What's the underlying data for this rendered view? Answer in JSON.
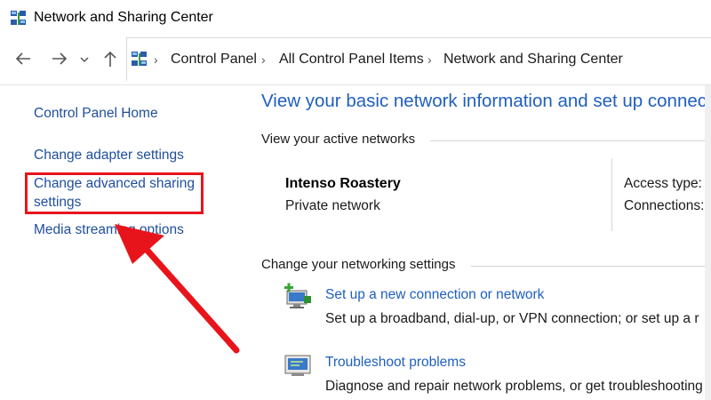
{
  "window": {
    "title": "Network and Sharing Center"
  },
  "nav": {
    "icons": [
      "back-arrow-icon",
      "forward-arrow-icon",
      "recent-dropdown-icon",
      "up-arrow-icon"
    ]
  },
  "breadcrumb": {
    "items": [
      "Control Panel",
      "All Control Panel Items",
      "Network and Sharing Center"
    ]
  },
  "sidebar": {
    "items": [
      {
        "label": "Control Panel Home"
      },
      {
        "label": "Change adapter settings"
      },
      {
        "label": "Change advanced sharing",
        "label_line2": "settings"
      },
      {
        "label": "Media streaming options"
      }
    ]
  },
  "main": {
    "title": "View your basic network information and set up connec",
    "active_networks_label": "View your active networks",
    "network": {
      "name": "Intenso Roastery",
      "type": "Private network",
      "access_type_label": "Access type:",
      "connections_label": "Connections:"
    },
    "change_settings_label": "Change your networking settings",
    "tasks": [
      {
        "link": "Set up a new connection or network",
        "desc": "Set up a broadband, dial-up, or VPN connection; or set up a r",
        "icon": "new-connection-icon"
      },
      {
        "link": "Troubleshoot problems",
        "desc": "Diagnose and repair network problems, or get troubleshooting",
        "icon": "troubleshoot-icon"
      }
    ]
  },
  "annotation": {
    "color": "#e8141c"
  }
}
